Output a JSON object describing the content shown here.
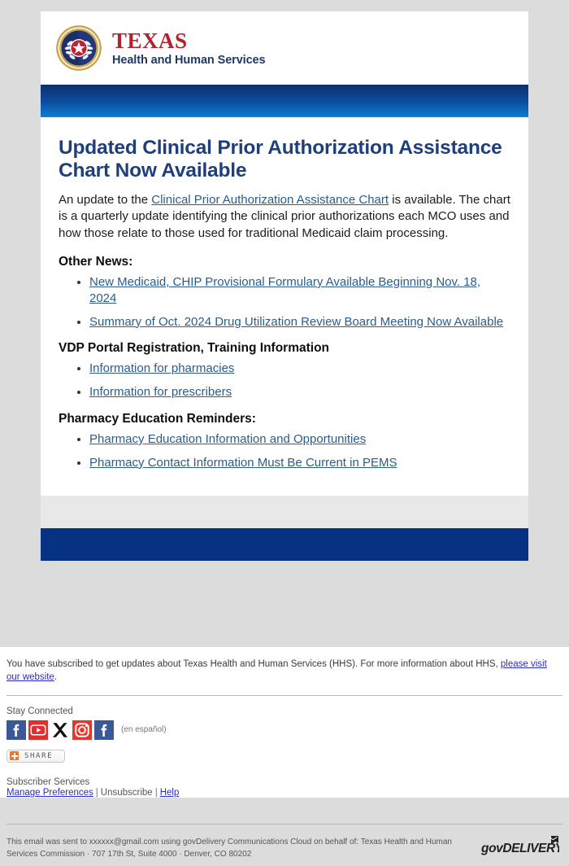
{
  "brand": {
    "seal_icon": "texas-state-seal-icon",
    "name_primary": "TEXAS",
    "name_secondary": "Health and Human Services",
    "colors": {
      "red": "#b3202e",
      "navy": "#1f3864",
      "band_navy": "#073283",
      "headline_blue": "#1f3f7a",
      "link_blue": "#2b5c8a",
      "footer_link": "#2a2ad0",
      "page_bg": "#dcdcdc",
      "grey_strip": "#e8e8e8"
    }
  },
  "article": {
    "headline": "Updated Clinical Prior Authorization Assistance Chart Now Available",
    "lede_prefix": "An update to the ",
    "lede_link": "Clinical Prior Authorization Assistance Chart",
    "lede_suffix": " is available. The chart is a quarterly update identifying the clinical prior authorizations each MCO uses and how those relate to those used for traditional Medicaid claim processing."
  },
  "sections": [
    {
      "heading": "Other News:",
      "items": [
        "New Medicaid, CHIP Provisional Formulary Available Beginning Nov. 18, 2024",
        "Summary of Oct. 2024 Drug Utilization Review Board Meeting Now Available"
      ]
    },
    {
      "heading": "VDP Portal Registration, Training Information",
      "items": [
        "Information for pharmacies",
        "Information for prescribers"
      ]
    },
    {
      "heading": "Pharmacy Education Reminders:",
      "items": [
        "Pharmacy Education Information and Opportunities",
        "Pharmacy Contact Information Must Be Current in PEMS"
      ]
    }
  ],
  "footer": {
    "subscribe_text_prefix": "You have subscribed to get updates about Texas Health and Human Services (HHS). For more information about HHS, ",
    "subscribe_link": "please visit our website",
    "subscribe_text_suffix": ".",
    "stay_connected_label": "Stay Connected",
    "social": [
      {
        "name": "facebook-icon",
        "label": "Facebook"
      },
      {
        "name": "youtube-icon",
        "label": "YouTube"
      },
      {
        "name": "x-twitter-icon",
        "label": "X"
      },
      {
        "name": "instagram-icon",
        "label": "Instagram"
      },
      {
        "name": "facebook-espanol-icon",
        "label": "Facebook en español"
      }
    ],
    "espanol_note": "(en español)",
    "share_label": "SHARE",
    "subscriber_services_label": "Subscriber Services",
    "manage_preferences": "Manage Preferences",
    "unsubscribe": "Unsubscribe",
    "help": "Help",
    "separator": "|",
    "sent_notice": "This email was sent to xxxxxx@gmail.com using govDelivery Communications Cloud on behalf of: Texas Health and Human Services Commission · 707 17th St, Suite 4000 · Denver, CO 80202",
    "govdelivery_logo": "govDELIVERY"
  }
}
